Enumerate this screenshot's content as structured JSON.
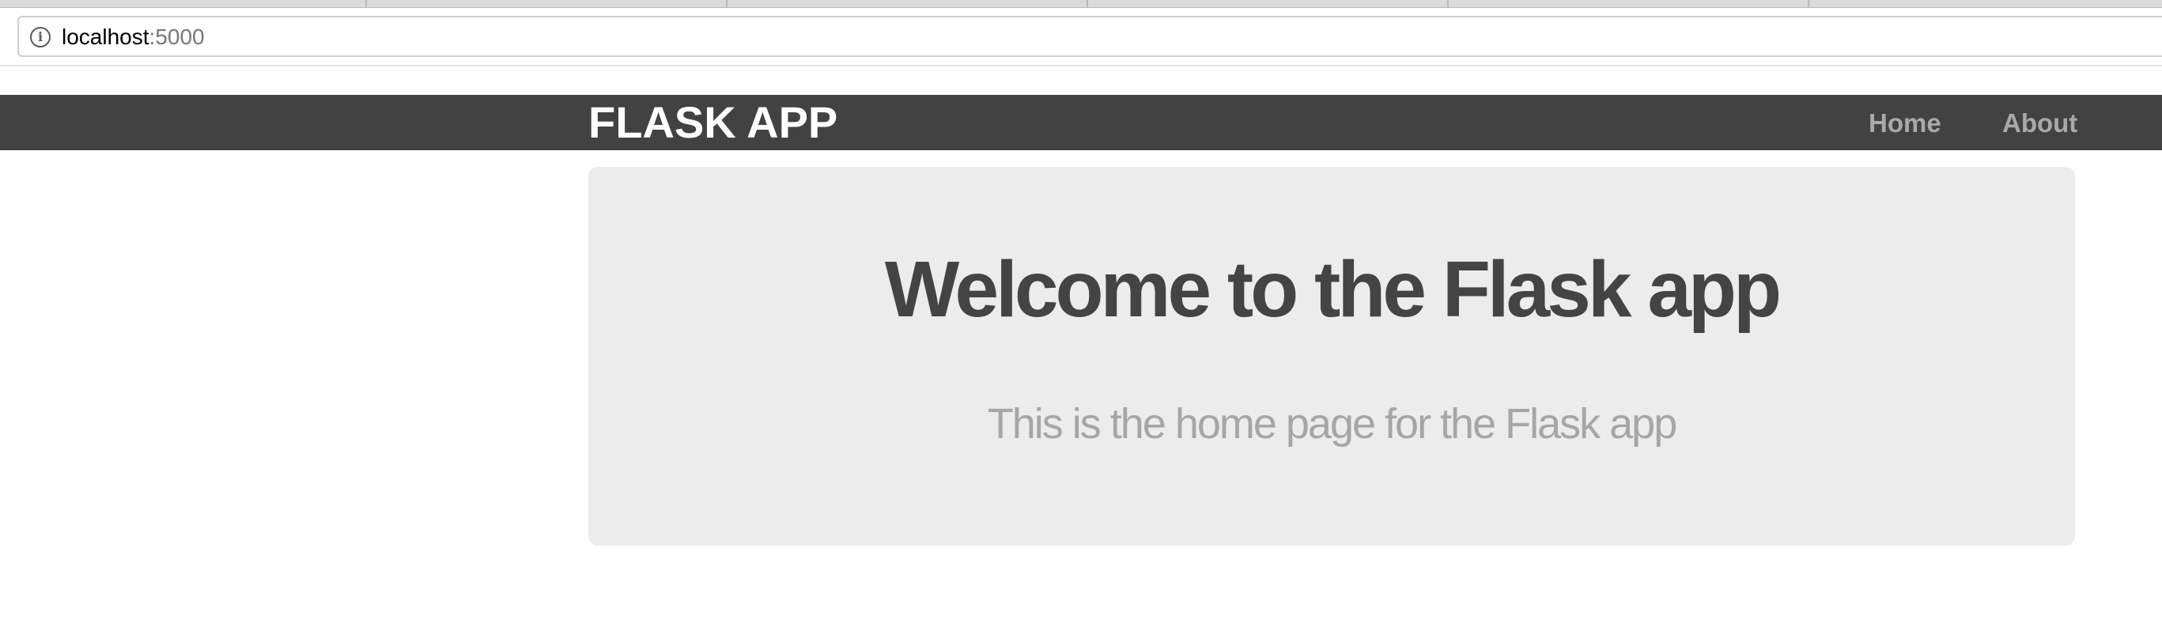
{
  "browser": {
    "url_host": "localhost",
    "url_port": ":5000"
  },
  "navbar": {
    "brand": "FLASK APP",
    "links": [
      {
        "label": "Home"
      },
      {
        "label": "About"
      }
    ]
  },
  "jumbotron": {
    "title": "Welcome to the Flask app",
    "subtitle": "This is the home page for the Flask app"
  },
  "colors": {
    "navbar_bg": "#424242",
    "brand": "#ffffff",
    "nav_link": "#a9a9a9",
    "jumbotron_bg": "#ececec",
    "title": "#444444",
    "subtitle": "#a6a6a6"
  },
  "icons": {
    "site_info": "info-icon"
  }
}
